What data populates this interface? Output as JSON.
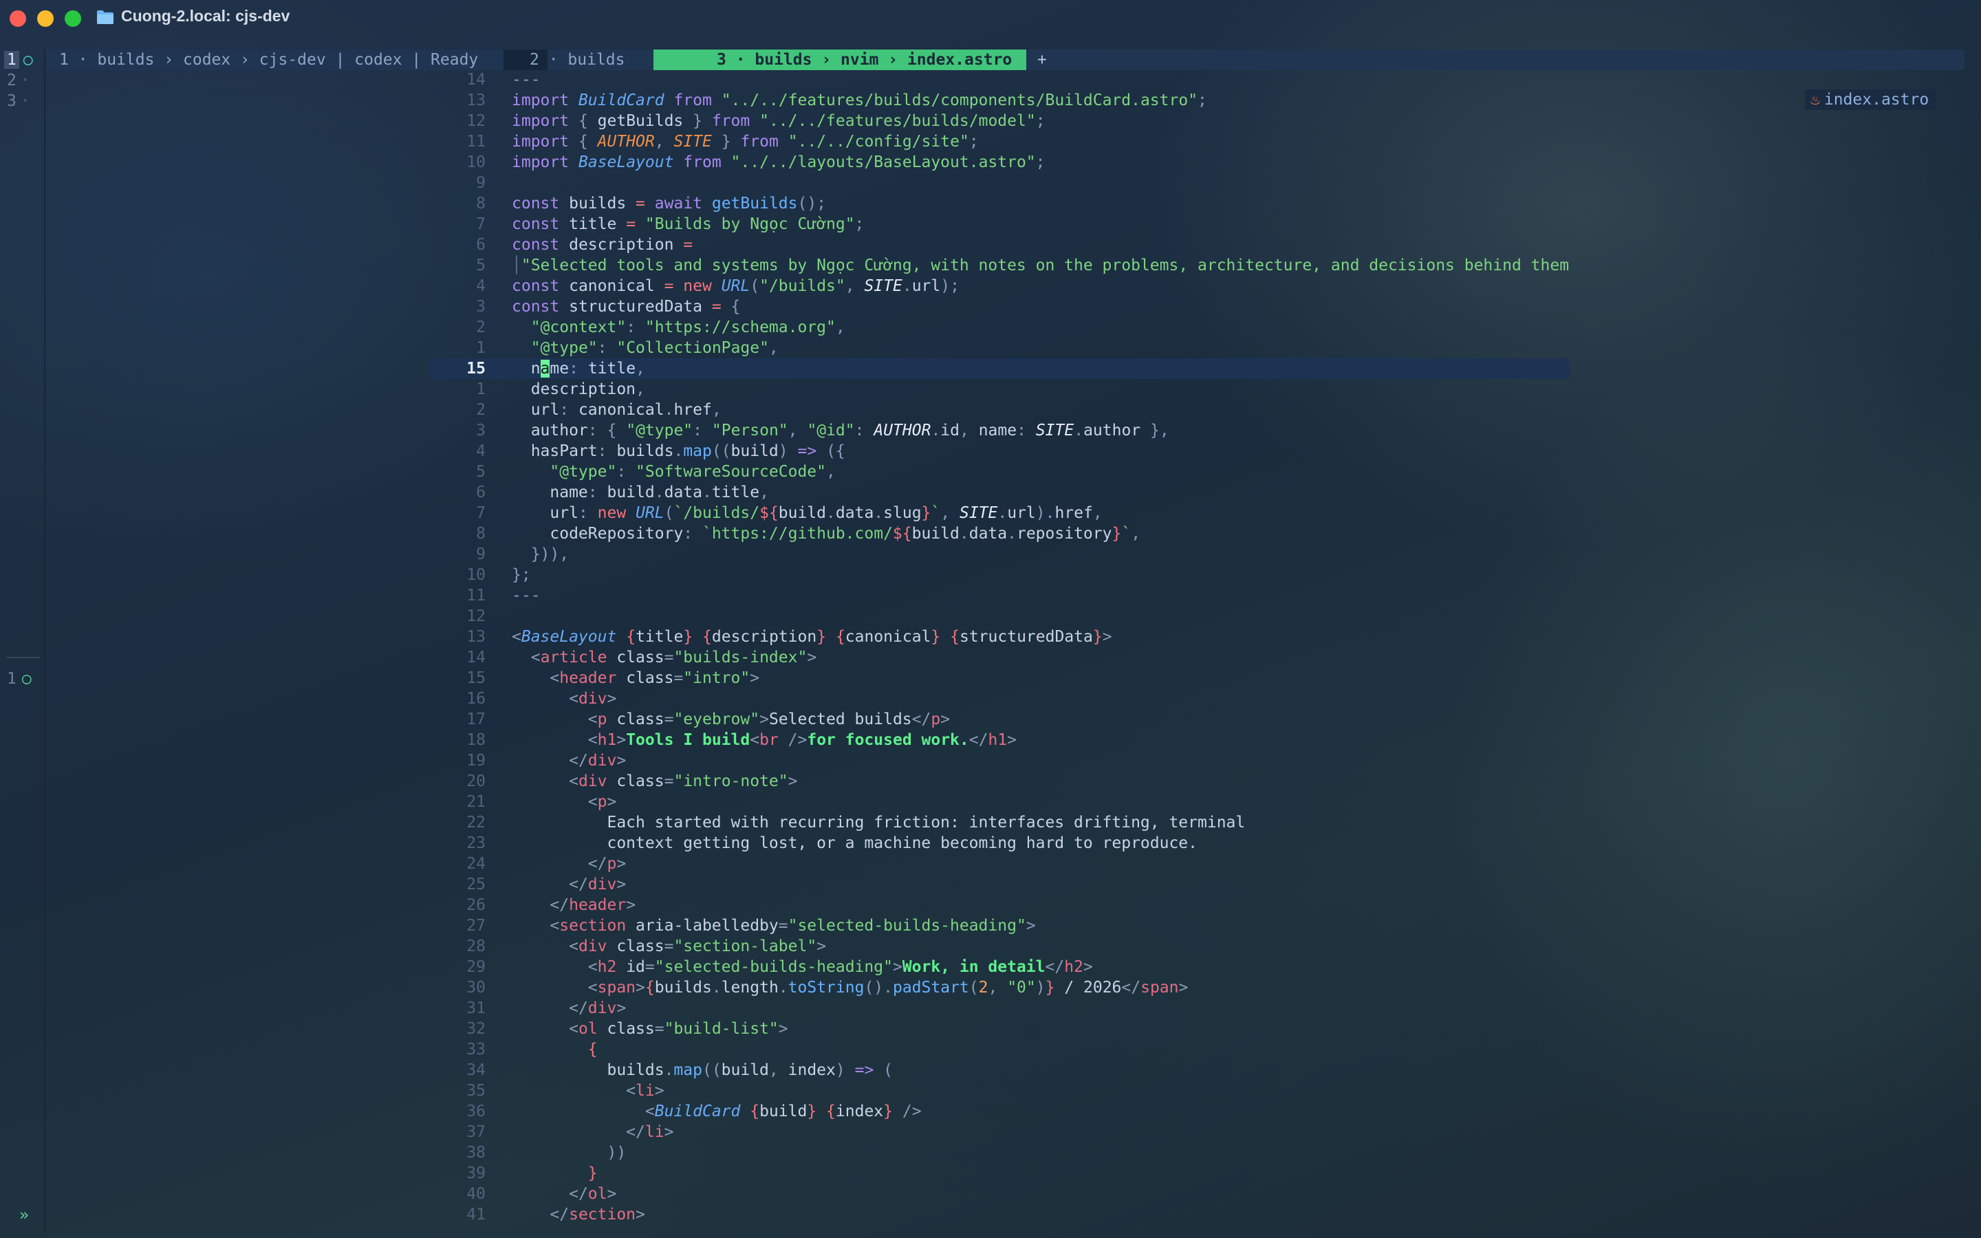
{
  "window": {
    "title": "Cuong-2.local: cjs-dev"
  },
  "tmux": {
    "panes_top": [
      {
        "num": "1",
        "marker": "○"
      },
      {
        "num": "2",
        "marker": "·"
      },
      {
        "num": "3",
        "marker": "·"
      }
    ],
    "pane_bottom": {
      "num": "1",
      "marker": "○"
    },
    "prompt": "»"
  },
  "tabline": {
    "tab1": "1 · builds › codex › cjs-dev | codex | Ready",
    "tab2": "2 · builds",
    "tab3": "3 · builds › nvim › index.astro",
    "add": "+"
  },
  "winbar": {
    "icon": "astro-icon",
    "file": "index.astro"
  },
  "editor": {
    "current_line": "15",
    "cursor_char": "a",
    "line_numbers": [
      "14",
      "13",
      "12",
      "11",
      "10",
      "9",
      "8",
      "7",
      "6",
      "5",
      "4",
      "3",
      "2",
      "1",
      "15",
      "1",
      "2",
      "3",
      "4",
      "5",
      "6",
      "7",
      "8",
      "9",
      "10",
      "11",
      "12",
      "13",
      "14",
      "15",
      "16",
      "17",
      "18",
      "19",
      "20",
      "21",
      "22",
      "23",
      "24",
      "25",
      "26",
      "27",
      "28",
      "29",
      "30",
      "31",
      "32",
      "33",
      "34",
      "35",
      "36",
      "37",
      "38",
      "39",
      "40",
      "41"
    ]
  },
  "colors": {
    "background": "#1d2b3a",
    "tab_active": "#40c57a",
    "keyword": "#a98af0",
    "string": "#7ed482",
    "type": "#69a9f5",
    "constant": "#ef8f4a",
    "tag": "#e36e86",
    "cursor": "#6ef39a"
  }
}
